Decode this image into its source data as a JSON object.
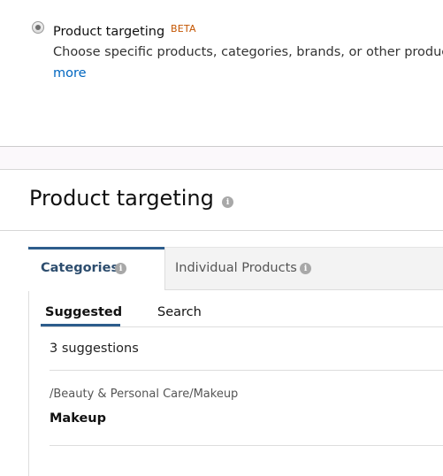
{
  "targeting_option": {
    "selected": true,
    "title": "Product targeting",
    "badge": "BETA",
    "description": "Choose specific products, categories, brands, or other product f",
    "more_link": "more"
  },
  "section": {
    "title": "Product targeting",
    "info_icon": "info-icon"
  },
  "tabs": [
    {
      "label": "Categories",
      "active": true,
      "info_icon": "info-icon"
    },
    {
      "label": "Individual Products",
      "active": false,
      "info_icon": "info-icon"
    }
  ],
  "subtabs": [
    {
      "label": "Suggested",
      "active": true
    },
    {
      "label": "Search",
      "active": false
    }
  ],
  "suggestions": {
    "count_text": "3 suggestions",
    "items": [
      {
        "path": "/Beauty & Personal Care/Makeup",
        "name": "Makeup"
      }
    ]
  },
  "colors": {
    "accent": "#2d5d8c",
    "link": "#0066c0",
    "beta": "#c45500"
  }
}
